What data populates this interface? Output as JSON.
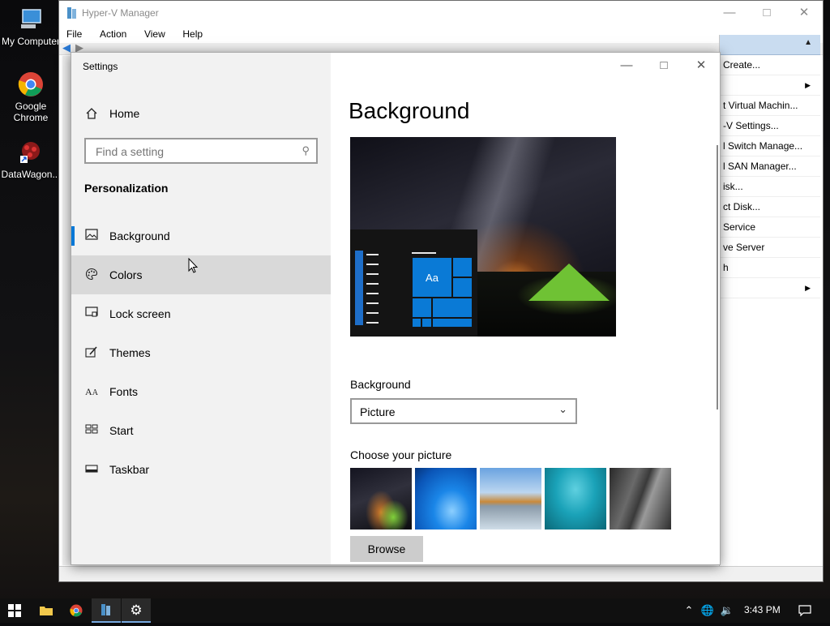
{
  "desktop": {
    "icons": [
      {
        "label": "My Computer",
        "icon": "monitor-icon"
      },
      {
        "label": "Google Chrome",
        "icon": "chrome-icon"
      },
      {
        "label": "DataWagon...",
        "icon": "datawagon-icon"
      }
    ]
  },
  "hyperv": {
    "title": "Hyper-V Manager",
    "menu": [
      "File",
      "Action",
      "View",
      "Help"
    ],
    "actions": [
      "Create...",
      "",
      "t Virtual Machin...",
      "-V Settings...",
      "l Switch Manage...",
      "l SAN Manager...",
      "isk...",
      "ct Disk...",
      "Service",
      "ve Server",
      "h",
      ""
    ]
  },
  "settings": {
    "app_title": "Settings",
    "home_label": "Home",
    "search_placeholder": "Find a setting",
    "section_title": "Personalization",
    "nav_items": [
      {
        "label": "Background",
        "icon": "picture-icon"
      },
      {
        "label": "Colors",
        "icon": "palette-icon"
      },
      {
        "label": "Lock screen",
        "icon": "lock-screen-icon"
      },
      {
        "label": "Themes",
        "icon": "themes-brush-icon"
      },
      {
        "label": "Fonts",
        "icon": "fonts-icon"
      },
      {
        "label": "Start",
        "icon": "start-tiles-icon"
      },
      {
        "label": "Taskbar",
        "icon": "taskbar-icon"
      }
    ],
    "selected_item": "Background",
    "page_title": "Background",
    "preview_tile_label": "Aa",
    "background_label": "Background",
    "background_value": "Picture",
    "choose_picture_label": "Choose your picture",
    "browse_label": "Browse"
  },
  "taskbar": {
    "clock": "3:43 PM"
  },
  "colors": {
    "accent": "#0078d7",
    "nav_bg": "#f2f2f2",
    "taskbar_bg": "#101010"
  }
}
